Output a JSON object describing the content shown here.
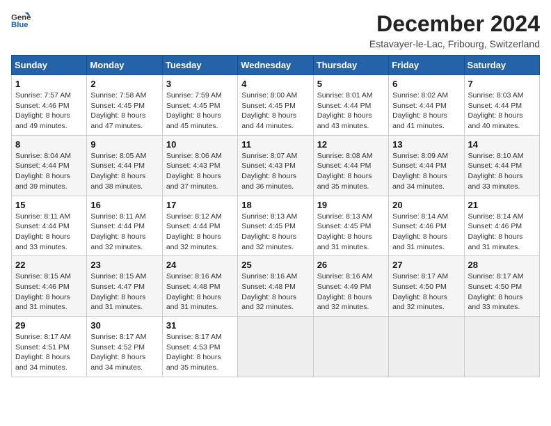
{
  "logo": {
    "line1": "General",
    "line2": "Blue"
  },
  "title": "December 2024",
  "subtitle": "Estavayer-le-Lac, Fribourg, Switzerland",
  "days_of_week": [
    "Sunday",
    "Monday",
    "Tuesday",
    "Wednesday",
    "Thursday",
    "Friday",
    "Saturday"
  ],
  "weeks": [
    [
      {
        "day": "1",
        "detail": "Sunrise: 7:57 AM\nSunset: 4:46 PM\nDaylight: 8 hours\nand 49 minutes."
      },
      {
        "day": "2",
        "detail": "Sunrise: 7:58 AM\nSunset: 4:45 PM\nDaylight: 8 hours\nand 47 minutes."
      },
      {
        "day": "3",
        "detail": "Sunrise: 7:59 AM\nSunset: 4:45 PM\nDaylight: 8 hours\nand 45 minutes."
      },
      {
        "day": "4",
        "detail": "Sunrise: 8:00 AM\nSunset: 4:45 PM\nDaylight: 8 hours\nand 44 minutes."
      },
      {
        "day": "5",
        "detail": "Sunrise: 8:01 AM\nSunset: 4:44 PM\nDaylight: 8 hours\nand 43 minutes."
      },
      {
        "day": "6",
        "detail": "Sunrise: 8:02 AM\nSunset: 4:44 PM\nDaylight: 8 hours\nand 41 minutes."
      },
      {
        "day": "7",
        "detail": "Sunrise: 8:03 AM\nSunset: 4:44 PM\nDaylight: 8 hours\nand 40 minutes."
      }
    ],
    [
      {
        "day": "8",
        "detail": "Sunrise: 8:04 AM\nSunset: 4:44 PM\nDaylight: 8 hours\nand 39 minutes."
      },
      {
        "day": "9",
        "detail": "Sunrise: 8:05 AM\nSunset: 4:44 PM\nDaylight: 8 hours\nand 38 minutes."
      },
      {
        "day": "10",
        "detail": "Sunrise: 8:06 AM\nSunset: 4:43 PM\nDaylight: 8 hours\nand 37 minutes."
      },
      {
        "day": "11",
        "detail": "Sunrise: 8:07 AM\nSunset: 4:43 PM\nDaylight: 8 hours\nand 36 minutes."
      },
      {
        "day": "12",
        "detail": "Sunrise: 8:08 AM\nSunset: 4:44 PM\nDaylight: 8 hours\nand 35 minutes."
      },
      {
        "day": "13",
        "detail": "Sunrise: 8:09 AM\nSunset: 4:44 PM\nDaylight: 8 hours\nand 34 minutes."
      },
      {
        "day": "14",
        "detail": "Sunrise: 8:10 AM\nSunset: 4:44 PM\nDaylight: 8 hours\nand 33 minutes."
      }
    ],
    [
      {
        "day": "15",
        "detail": "Sunrise: 8:11 AM\nSunset: 4:44 PM\nDaylight: 8 hours\nand 33 minutes."
      },
      {
        "day": "16",
        "detail": "Sunrise: 8:11 AM\nSunset: 4:44 PM\nDaylight: 8 hours\nand 32 minutes."
      },
      {
        "day": "17",
        "detail": "Sunrise: 8:12 AM\nSunset: 4:44 PM\nDaylight: 8 hours\nand 32 minutes."
      },
      {
        "day": "18",
        "detail": "Sunrise: 8:13 AM\nSunset: 4:45 PM\nDaylight: 8 hours\nand 32 minutes."
      },
      {
        "day": "19",
        "detail": "Sunrise: 8:13 AM\nSunset: 4:45 PM\nDaylight: 8 hours\nand 31 minutes."
      },
      {
        "day": "20",
        "detail": "Sunrise: 8:14 AM\nSunset: 4:46 PM\nDaylight: 8 hours\nand 31 minutes."
      },
      {
        "day": "21",
        "detail": "Sunrise: 8:14 AM\nSunset: 4:46 PM\nDaylight: 8 hours\nand 31 minutes."
      }
    ],
    [
      {
        "day": "22",
        "detail": "Sunrise: 8:15 AM\nSunset: 4:46 PM\nDaylight: 8 hours\nand 31 minutes."
      },
      {
        "day": "23",
        "detail": "Sunrise: 8:15 AM\nSunset: 4:47 PM\nDaylight: 8 hours\nand 31 minutes."
      },
      {
        "day": "24",
        "detail": "Sunrise: 8:16 AM\nSunset: 4:48 PM\nDaylight: 8 hours\nand 31 minutes."
      },
      {
        "day": "25",
        "detail": "Sunrise: 8:16 AM\nSunset: 4:48 PM\nDaylight: 8 hours\nand 32 minutes."
      },
      {
        "day": "26",
        "detail": "Sunrise: 8:16 AM\nSunset: 4:49 PM\nDaylight: 8 hours\nand 32 minutes."
      },
      {
        "day": "27",
        "detail": "Sunrise: 8:17 AM\nSunset: 4:50 PM\nDaylight: 8 hours\nand 32 minutes."
      },
      {
        "day": "28",
        "detail": "Sunrise: 8:17 AM\nSunset: 4:50 PM\nDaylight: 8 hours\nand 33 minutes."
      }
    ],
    [
      {
        "day": "29",
        "detail": "Sunrise: 8:17 AM\nSunset: 4:51 PM\nDaylight: 8 hours\nand 34 minutes."
      },
      {
        "day": "30",
        "detail": "Sunrise: 8:17 AM\nSunset: 4:52 PM\nDaylight: 8 hours\nand 34 minutes."
      },
      {
        "day": "31",
        "detail": "Sunrise: 8:17 AM\nSunset: 4:53 PM\nDaylight: 8 hours\nand 35 minutes."
      },
      {
        "day": "",
        "detail": ""
      },
      {
        "day": "",
        "detail": ""
      },
      {
        "day": "",
        "detail": ""
      },
      {
        "day": "",
        "detail": ""
      }
    ]
  ]
}
